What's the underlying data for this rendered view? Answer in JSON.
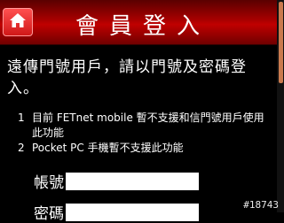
{
  "header": {
    "title": "會員登入",
    "home_icon": "home-icon"
  },
  "intro": "遠傳門號用戶，請以門號及密碼登入。",
  "notes": [
    {
      "num": "1",
      "text": "目前 FETnet mobile 暫不支援和信門號用戶使用此功能"
    },
    {
      "num": "2",
      "text": "Pocket PC 手機暫不支援此功能"
    }
  ],
  "form": {
    "account_label": "帳號",
    "account_value": "",
    "password_label": "密碼",
    "password_value": ""
  },
  "watermark": "#18743",
  "colors": {
    "header": "#b00000",
    "background": "#000000",
    "home_button": "#e02828"
  }
}
